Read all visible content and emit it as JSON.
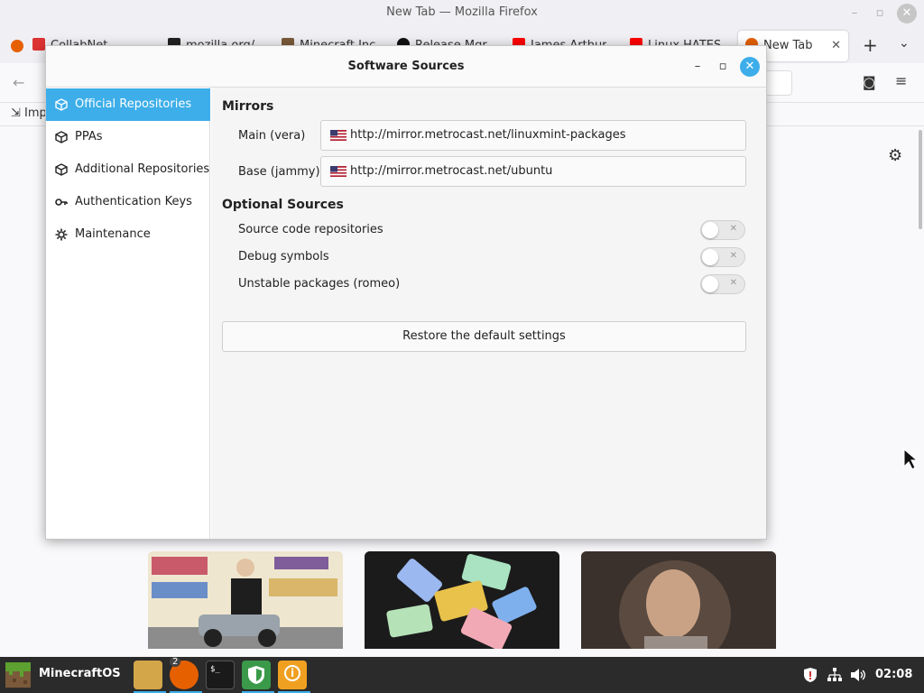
{
  "firefox": {
    "window_title": "New Tab — Mozilla Firefox",
    "tabs": [
      {
        "label": "CollabNet"
      },
      {
        "label": "mozilla.org/..."
      },
      {
        "label": "Minecraft Inc"
      },
      {
        "label": "Release Mgr"
      },
      {
        "label": "James Arthur"
      },
      {
        "label": "Linux HATES"
      },
      {
        "label": "New Tab",
        "active": true
      }
    ],
    "bookmark_import_label": "Imp"
  },
  "dialog": {
    "title": "Software Sources",
    "sidebar": [
      {
        "label": "Official Repositories",
        "icon": "package-icon",
        "active": true
      },
      {
        "label": "PPAs",
        "icon": "package-icon"
      },
      {
        "label": "Additional Repositories",
        "icon": "package-icon"
      },
      {
        "label": "Authentication Keys",
        "icon": "key-icon"
      },
      {
        "label": "Maintenance",
        "icon": "gear-icon"
      }
    ],
    "mirrors": {
      "heading": "Mirrors",
      "main_label": "Main (vera)",
      "main_url": "http://mirror.metrocast.net/linuxmint-packages",
      "base_label": "Base (jammy)",
      "base_url": "http://mirror.metrocast.net/ubuntu"
    },
    "optional": {
      "heading": "Optional Sources",
      "items": [
        {
          "label": "Source code repositories",
          "enabled": false
        },
        {
          "label": "Debug symbols",
          "enabled": false
        },
        {
          "label": "Unstable packages (romeo)",
          "enabled": false
        }
      ]
    },
    "restore_label": "Restore the default settings"
  },
  "taskbar": {
    "menu_label": "MinecraftOS",
    "firefox_badge": "2",
    "clock": "02:08"
  },
  "colors": {
    "accent": "#3daee9",
    "taskbar": "#2b2b2b"
  }
}
